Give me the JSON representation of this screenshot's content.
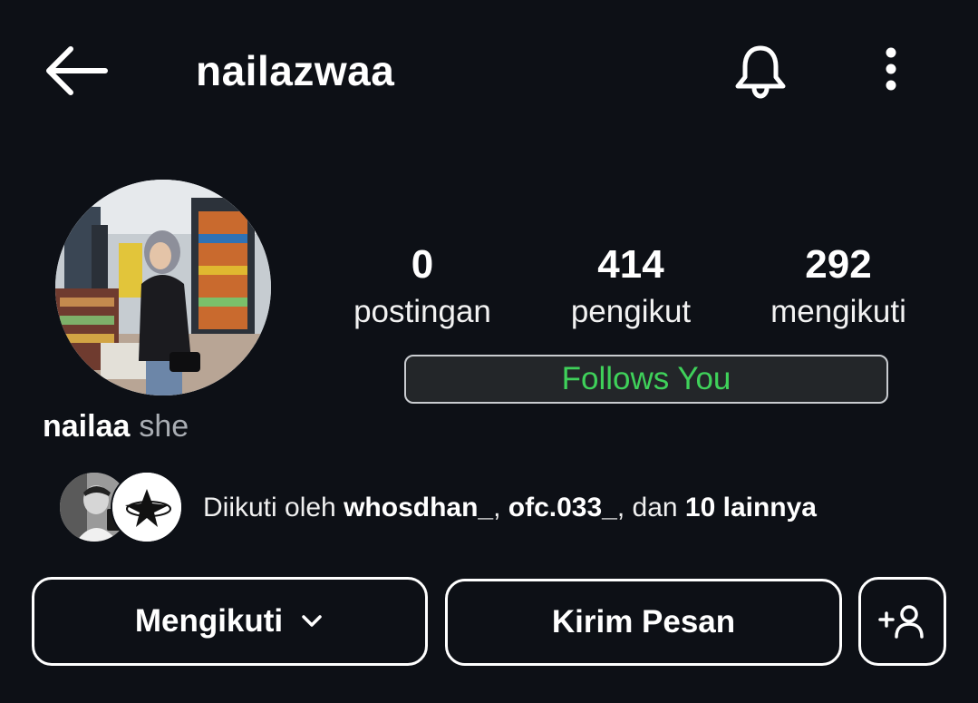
{
  "header": {
    "username": "nailazwaa",
    "back_icon": "arrow-left-icon",
    "notification_icon": "bell-icon",
    "more_icon": "more-vertical-icon"
  },
  "profile": {
    "avatar": "profile-photo",
    "stats": [
      {
        "value": "0",
        "label": "postingan"
      },
      {
        "value": "414",
        "label": "pengikut"
      },
      {
        "value": "292",
        "label": "mengikuti"
      }
    ],
    "follows_you": "Follows You",
    "follows_you_color": "#3fd15a",
    "display_name": "nailaa",
    "pronouns": "she"
  },
  "followed_by": {
    "prefix": "Diikuti oleh ",
    "user1": "whosdhan_",
    "sep1": ", ",
    "user2": "ofc.033_",
    "sep2": ", dan ",
    "others": "10 lainnya"
  },
  "actions": {
    "following_label": "Mengikuti",
    "message_label": "Kirim Pesan",
    "add_icon": "add-person-icon"
  },
  "colors": {
    "background": "#0d1016",
    "text": "#ffffff",
    "secondary_text": "#a9adb3"
  }
}
